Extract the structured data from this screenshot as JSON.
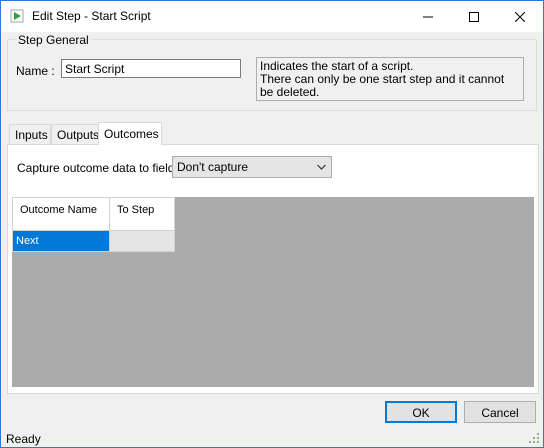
{
  "window": {
    "title": "Edit Step - Start Script",
    "icons": {
      "app": "play-icon",
      "minimize": "minimize-icon",
      "maximize": "maximize-icon",
      "close": "close-icon"
    }
  },
  "step_general": {
    "legend": "Step General",
    "name_label": "Name :",
    "name_value": "Start Script",
    "description": "Indicates the start of a script.\nThere can only be one start step and it cannot be deleted."
  },
  "tabs": [
    {
      "label": "Inputs",
      "selected": false
    },
    {
      "label": "Outputs",
      "selected": false
    },
    {
      "label": "Outcomes",
      "selected": true
    }
  ],
  "outcomes": {
    "capture_label": "Capture outcome data to field?",
    "capture_value": "Don't capture",
    "columns": [
      "Outcome Name",
      "To Step"
    ],
    "rows": [
      {
        "outcome": "Next",
        "to_step": ""
      }
    ]
  },
  "buttons": {
    "ok": "OK",
    "cancel": "Cancel"
  },
  "status": {
    "text": "Ready"
  },
  "colors": {
    "accent": "#0078d7",
    "grid_bg": "#ababab",
    "selected_cell": "#0078d7"
  }
}
